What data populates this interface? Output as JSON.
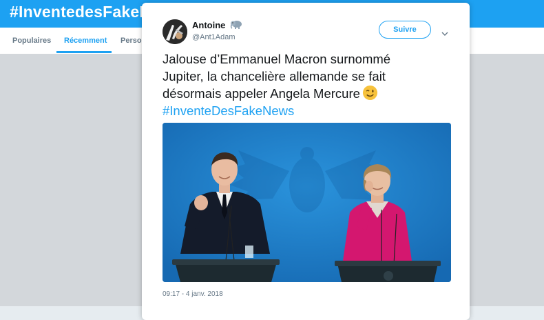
{
  "background": {
    "hashtag_title": "#InventedesFakeNew",
    "tabs": [
      {
        "label": "Populaires",
        "active": false
      },
      {
        "label": "Récemment",
        "active": true
      },
      {
        "label": "Perso",
        "active": false
      }
    ]
  },
  "tweet": {
    "user": {
      "name": "Antoine",
      "handle": "@Ant1Adam",
      "badge_icon": "elephant-emoji"
    },
    "follow_label": "Suivre",
    "menu_icon": "chevron-down-icon",
    "text_lines": [
      "Jalouse d’Emmanuel Macron surnommé",
      "Jupiter, la chancelière allemande se fait",
      "désormais appeler Angela Mercure"
    ],
    "emoji": "winking-face-emoji",
    "hashtag": "#InventeDesFakeNews",
    "timestamp": "09:17 - 4 janv. 2018"
  },
  "colors": {
    "accent": "#1da1f2",
    "overlay": "#d3d7db",
    "photo_background": "#1f7fc8"
  }
}
